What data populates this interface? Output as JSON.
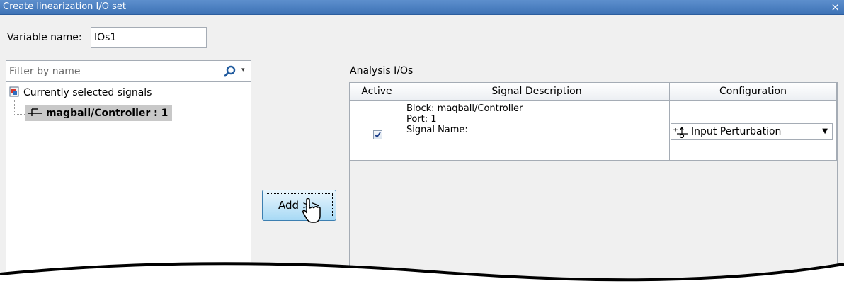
{
  "window": {
    "title": "Create linearization I/O set",
    "close_glyph": "×"
  },
  "variable": {
    "label": "Variable name:",
    "value": "IOs1"
  },
  "filter": {
    "placeholder": "Filter by name",
    "search_icon": "search-icon",
    "dropdown_glyph": "▾"
  },
  "tree": {
    "root_label": "Currently selected signals",
    "children": [
      {
        "label": "magball/Controller : 1"
      }
    ]
  },
  "add_button": {
    "label": "Add >>"
  },
  "analysis": {
    "label": "Analysis I/Os",
    "columns": [
      "Active",
      "Signal Description",
      "Configuration"
    ],
    "rows": [
      {
        "active": true,
        "block": "Block: maqball/Controller",
        "port": "Port: 1",
        "signal_name": "Signal Name:",
        "configuration": "Input Perturbation"
      }
    ]
  },
  "colors": {
    "title_bar": "#3e73b6",
    "selection": "#c8c8c8",
    "button": "#a7d9f5"
  }
}
